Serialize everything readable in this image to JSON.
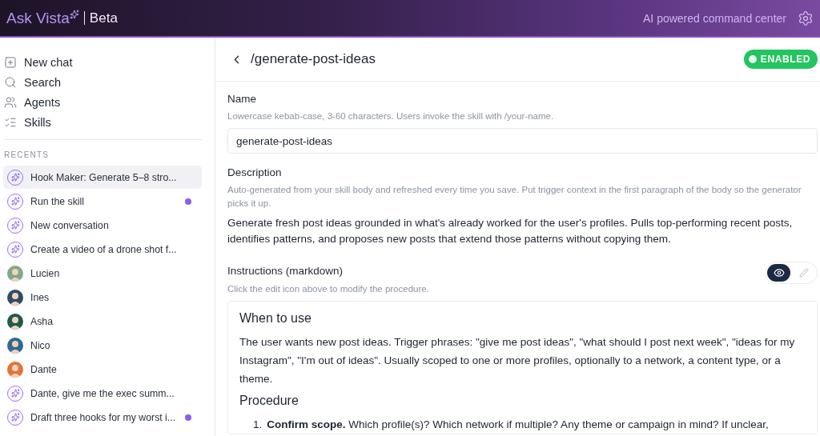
{
  "header": {
    "brand": "Ask Vista",
    "badge": "Beta",
    "tagline": "AI powered command center"
  },
  "sidebar": {
    "nav": [
      {
        "kind": "new",
        "label": "New chat"
      },
      {
        "kind": "search",
        "label": "Search"
      },
      {
        "kind": "agents",
        "label": "Agents"
      },
      {
        "kind": "skills",
        "label": "Skills"
      }
    ],
    "recents_title": "RECENTS",
    "recents": [
      {
        "kind": "chat",
        "label": "Hook Maker: Generate 5–8 stro...",
        "selected": true,
        "unread": false
      },
      {
        "kind": "chat",
        "label": "Run the skill",
        "selected": false,
        "unread": true
      },
      {
        "kind": "chat",
        "label": "New conversation",
        "selected": false,
        "unread": false
      },
      {
        "kind": "chat",
        "label": "Create a video of a drone shot f...",
        "selected": false,
        "unread": false
      },
      {
        "kind": "person",
        "label": "Lucien",
        "color": "#7fa98a",
        "selected": false,
        "unread": false
      },
      {
        "kind": "person",
        "label": "Ines",
        "color": "#2e4b6b",
        "selected": false,
        "unread": false
      },
      {
        "kind": "person",
        "label": "Asha",
        "color": "#1f5a4a",
        "selected": false,
        "unread": false
      },
      {
        "kind": "person",
        "label": "Nico",
        "color": "#2f6a93",
        "selected": false,
        "unread": false
      },
      {
        "kind": "person",
        "label": "Dante",
        "color": "#e2743a",
        "selected": false,
        "unread": false
      },
      {
        "kind": "chat",
        "label": "Dante, give me the exec summ...",
        "selected": false,
        "unread": false
      },
      {
        "kind": "chat",
        "label": "Draft three hooks for my worst i...",
        "selected": false,
        "unread": true
      }
    ]
  },
  "skill": {
    "title": "/generate-post-ideas",
    "enabled": true,
    "status_label": "ENABLED",
    "name": {
      "label": "Name",
      "hint": "Lowercase kebab-case, 3-60 characters. Users invoke the skill with /your-name.",
      "value": "generate-post-ideas"
    },
    "description": {
      "label": "Description",
      "hint": "Auto-generated from your skill body and refreshed every time you save. Put trigger context in the first paragraph of the body so the generator picks it up.",
      "text": "Generate fresh post ideas grounded in what's already worked for the user's profiles. Pulls top-performing recent posts, identifies patterns, and proposes new posts that extend those patterns without copying them."
    },
    "instructions": {
      "label": "Instructions (markdown)",
      "hint": "Click the edit icon above to modify the procedure.",
      "modes": [
        {
          "kind": "preview",
          "selected": true
        },
        {
          "kind": "edit",
          "selected": false
        }
      ],
      "blocks": [
        {
          "kind": "heading",
          "text": "When to use"
        },
        {
          "kind": "paragraph",
          "text": "The user wants new post ideas. Trigger phrases: \"give me post ideas\", \"what should I post next week\", \"ideas for my Instagram\", \"I'm out of ideas\". Usually scoped to one or more profiles, optionally to a network, a content type, or a theme."
        },
        {
          "kind": "heading",
          "text": "Procedure"
        },
        {
          "kind": "list_item",
          "number": "1.",
          "text": "**Confirm scope.** Which profile(s)? Which network if multiple? Any theme or campaign in mind? If unclear,"
        }
      ]
    }
  }
}
